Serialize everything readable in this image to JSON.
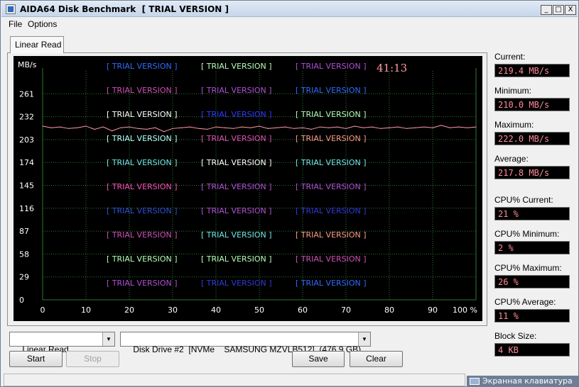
{
  "window": {
    "title": "AIDA64 Disk Benchmark  [ TRIAL VERSION ]",
    "minimize": "_",
    "maximize": "□",
    "close": "X"
  },
  "menu": {
    "file": "File",
    "options": "Options"
  },
  "tab": {
    "label": "Linear Read"
  },
  "chart_data": {
    "type": "line",
    "ylabel": "MB/s",
    "xlabel": "",
    "timer": "41:13",
    "ylim": [
      0,
      290
    ],
    "xlim": [
      0,
      100
    ],
    "y_ticks": [
      "261",
      "232",
      "203",
      "174",
      "145",
      "116",
      "87",
      "58",
      "29",
      "0"
    ],
    "x_ticks": [
      "0",
      "10",
      "20",
      "30",
      "40",
      "50",
      "60",
      "70",
      "80",
      "90",
      "100 %"
    ],
    "watermark": "[ TRIAL VERSION ]",
    "watermark_colors": [
      [
        "#2f6bff",
        "#b6ffb6",
        "#b04fd6"
      ],
      [
        "#d14fb6",
        "#b04fd6",
        "#2f6bff"
      ],
      [
        "#ffffff",
        "#2f3bff",
        "#b6ffb6"
      ],
      [
        "#b6ffff",
        "#e24fb6",
        "#ff9a8a"
      ],
      [
        "#6fe6e6",
        "#ffffff",
        "#6fe6e6"
      ],
      [
        "#ff4fb6",
        "#b04fd6",
        "#b04fd6"
      ],
      [
        "#2f4fd6",
        "#b04fd6",
        "#2f3bd6"
      ],
      [
        "#d14fb6",
        "#6fe6e6",
        "#ff9a8a"
      ],
      [
        "#b6ffb6",
        "#b6ffb6",
        "#d14fb6"
      ],
      [
        "#b04fd6",
        "#2f3bd6",
        "#2f6bff"
      ]
    ],
    "series": [
      {
        "color": "#ff9aa6",
        "x": [
          0,
          2,
          4,
          6,
          8,
          10,
          12,
          14,
          16,
          18,
          20,
          22,
          24,
          26,
          28,
          30,
          32,
          34,
          36,
          38,
          40,
          42,
          44,
          46,
          48,
          50,
          52,
          54,
          56,
          58,
          60,
          62,
          64,
          66,
          68,
          70,
          72,
          74,
          76,
          78,
          80,
          82,
          84,
          86,
          88,
          90,
          92,
          94,
          96,
          98,
          100
        ],
        "values": [
          220,
          218,
          219,
          217,
          218,
          220,
          216,
          219,
          214,
          218,
          219,
          217,
          216,
          218,
          213,
          217,
          218,
          219,
          217,
          216,
          219,
          218,
          217,
          219,
          218,
          220,
          217,
          218,
          219,
          217,
          218,
          216,
          219,
          218,
          219,
          217,
          220,
          218,
          219,
          217,
          218,
          219,
          217,
          218,
          219,
          218,
          221,
          218,
          219,
          218,
          219
        ]
      }
    ]
  },
  "stats": {
    "current": {
      "label": "Current:",
      "value": "219.4 MB/s"
    },
    "minimum": {
      "label": "Minimum:",
      "value": "210.0 MB/s"
    },
    "maximum": {
      "label": "Maximum:",
      "value": "222.0 MB/s"
    },
    "average": {
      "label": "Average:",
      "value": "217.8 MB/s"
    },
    "cpu_current": {
      "label": "CPU% Current:",
      "value": "21 %"
    },
    "cpu_minimum": {
      "label": "CPU% Minimum:",
      "value": "2 %"
    },
    "cpu_maximum": {
      "label": "CPU% Maximum:",
      "value": "26 %"
    },
    "cpu_average": {
      "label": "CPU% Average:",
      "value": "11 %"
    },
    "block_size": {
      "label": "Block Size:",
      "value": "4 KB"
    }
  },
  "controls": {
    "test_select": "Linear Read",
    "drive_select": "Disk Drive #2  [NVMe    SAMSUNG MZVLB512]  (476.9 GB)",
    "start": "Start",
    "stop": "Stop",
    "save": "Save",
    "clear": "Clear"
  },
  "taskbar": {
    "osk": "Экранная клавиатура"
  },
  "colors": {
    "chart_bg": "#000000",
    "grid": "#2c7a2c",
    "stat_value": "#ff8a9a"
  }
}
